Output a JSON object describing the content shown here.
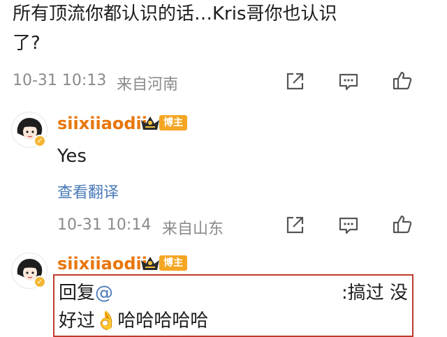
{
  "post": {
    "text_line1": "所有顶流你都认识的话…Kris哥你也认识",
    "text_line2": "了?",
    "time": "10-31 10:13",
    "source": "来自河南"
  },
  "comments": [
    {
      "username": "siixiiaodii",
      "badge": "博主",
      "text": "Yes",
      "translate": "查看翻译",
      "time": "10-31 10:14",
      "source": "来自山东"
    },
    {
      "username": "siixiiaodii",
      "badge": "博主",
      "reply_prefix": "回复",
      "reply_at": "@",
      "reply_right": ":搞过 没",
      "reply_line2": "好过👌哈哈哈哈哈"
    }
  ],
  "icons": {
    "share": "share-icon",
    "comment": "comment-icon",
    "like": "like-icon",
    "crown": "crown-icon",
    "verified": "verified-icon"
  },
  "colors": {
    "username": "#e8760b",
    "badge": "#f5a623",
    "link": "#4a7ab8",
    "meta": "#8a8a8a",
    "reply_border": "#c0392b"
  }
}
